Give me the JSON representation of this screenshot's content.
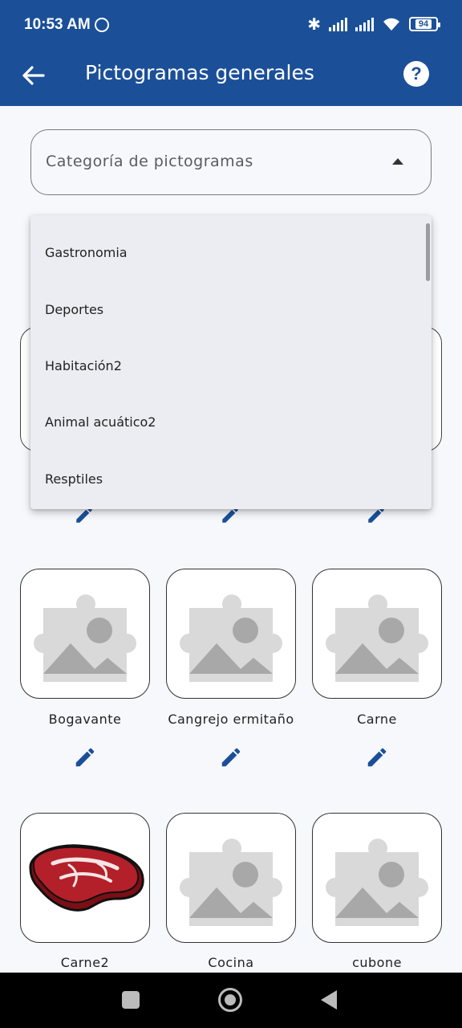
{
  "status_bar": {
    "time": "10:53 AM",
    "battery": "94",
    "icons": [
      "whatsapp-icon",
      "bluetooth-icon",
      "signal-icon",
      "signal-icon",
      "wifi-icon",
      "battery-icon"
    ]
  },
  "app_bar": {
    "title": "Pictogramas generales",
    "back_icon": "arrow-back-icon",
    "help_icon": "help-icon"
  },
  "category_select": {
    "label": "Categoría de pictogramas",
    "icon": "caret-up-icon"
  },
  "dropdown": {
    "options": [
      "Gastronomia",
      "Deportes",
      "Habitación2",
      "Animal acuático2",
      "Resptiles"
    ]
  },
  "pictograms": [
    {
      "label": "Bogavante",
      "image": "placeholder"
    },
    {
      "label": "Cangrejo ermitaño",
      "image": "placeholder"
    },
    {
      "label": "Carne",
      "image": "placeholder"
    },
    {
      "label": "Carne2",
      "image": "steak"
    },
    {
      "label": "Cocina",
      "image": "placeholder"
    },
    {
      "label": "cubone",
      "image": "placeholder"
    }
  ],
  "colors": {
    "primary": "#1b5099",
    "background": "#f7f8fc",
    "dropdown_bg": "#ebedf2",
    "placeholder_gray": "#d9d9d9",
    "placeholder_dark": "#a8a8a8",
    "steak_red": "#b3202a"
  },
  "nav_bar": {
    "icons": [
      "recents-icon",
      "home-icon",
      "back-icon"
    ]
  }
}
